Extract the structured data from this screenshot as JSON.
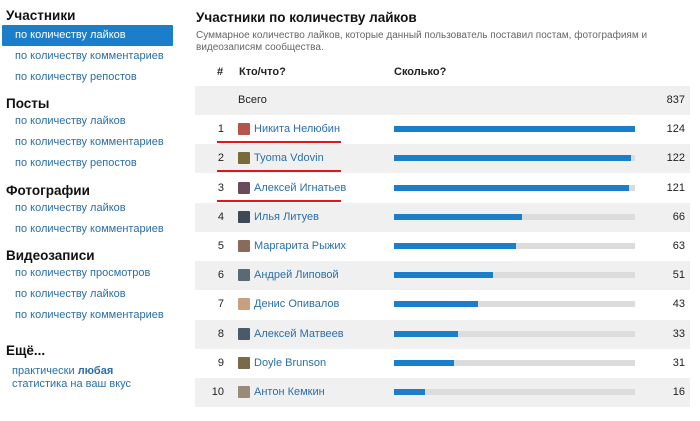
{
  "sidebar": {
    "sections": [
      {
        "title": "Участники",
        "items": [
          "по количеству лайков",
          "по количеству комментариев",
          "по количеству репостов"
        ]
      },
      {
        "title": "Посты",
        "items": [
          "по количеству лайков",
          "по количеству комментариев",
          "по количеству репостов"
        ]
      },
      {
        "title": "Фотографии",
        "items": [
          "по количеству лайков",
          "по количеству комментариев"
        ]
      },
      {
        "title": "Видеозаписи",
        "items": [
          "по количеству просмотров",
          "по количеству лайков",
          "по количеству комментариев"
        ]
      }
    ],
    "active_item": "по количеству лайков",
    "more": {
      "title": "Ещё...",
      "line1_prefix": "практически ",
      "line1_bold": "любая",
      "line2": "статистика на ваш вкус"
    }
  },
  "main": {
    "title": "Участники по количеству лайков",
    "subtitle": "Суммарное количество лайков, которые данный пользователь поставил постам, фотографиям и видеозаписям сообщества.",
    "columns": {
      "num": "#",
      "who": "Кто/что?",
      "how": "Сколько?"
    },
    "total": {
      "label": "Всего",
      "value": 837
    },
    "rows": [
      {
        "rank": "1",
        "name": "Никита Нелюбин",
        "value": 124,
        "avatar_color": "#b5544a"
      },
      {
        "rank": "2",
        "name": "Tyoma Vdovin",
        "value": 122,
        "avatar_color": "#7a6a3a"
      },
      {
        "rank": "3",
        "name": "Алексей Игнатьев",
        "value": 121,
        "avatar_color": "#6a4a5e"
      },
      {
        "rank": "4",
        "name": "Илья Литуев",
        "value": 66,
        "avatar_color": "#3d4a55"
      },
      {
        "rank": "5",
        "name": "Маргарита Рыжих",
        "value": 63,
        "avatar_color": "#8a6a5a"
      },
      {
        "rank": "6",
        "name": "Андрей Липовой",
        "value": 51,
        "avatar_color": "#5a6a75"
      },
      {
        "rank": "7",
        "name": "Денис Опивалов",
        "value": 43,
        "avatar_color": "#c8a080"
      },
      {
        "rank": "8",
        "name": "Алексей Матвеев",
        "value": 33,
        "avatar_color": "#4a5a6a"
      },
      {
        "rank": "9",
        "name": "Doyle Brunson",
        "value": 31,
        "avatar_color": "#7a6a4a"
      },
      {
        "rank": "10",
        "name": "Антон Кемкин",
        "value": 16,
        "avatar_color": "#9a8a7a"
      }
    ],
    "bar_max": 124,
    "highlighted_ranks": [
      "1",
      "2",
      "3"
    ],
    "colors": {
      "accent": "#1a7ecb",
      "link": "#2a6ea8",
      "bar_track": "#dcdcdc",
      "underline": "#e0161c",
      "row_shade": "#f0f0f0"
    }
  }
}
